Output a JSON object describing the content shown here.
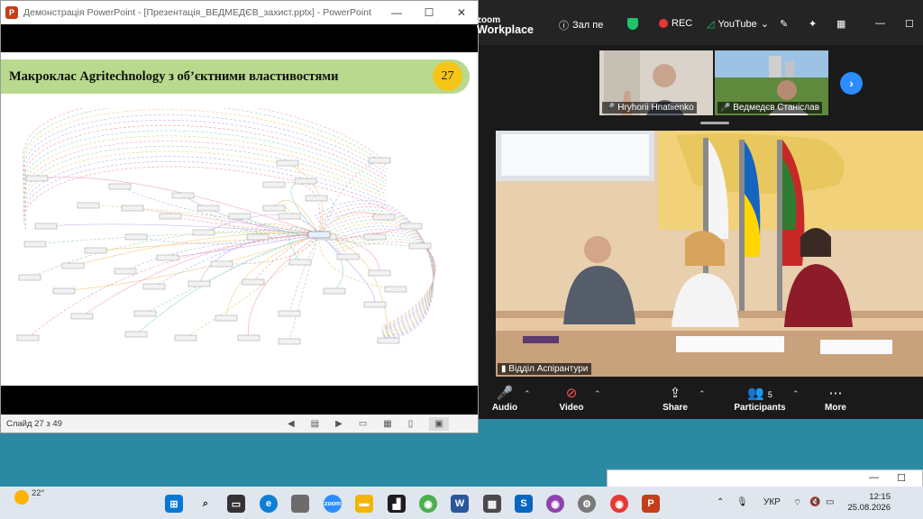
{
  "ppt": {
    "title": "Демонстрація PowerPoint - [Презентація_ВЕДМЕДЄВ_захист.pptx] - PowerPoint",
    "slide_title": "Макроклас  Agritechnology з об’єктними властивостями",
    "slide_number": "27",
    "status": "Слайд 27 з 49"
  },
  "zoom": {
    "brand_top": "zoom",
    "brand_bottom": "Workplace",
    "view_label": "Зал пе",
    "rec_label": "REC",
    "youtube_label": "YouTube",
    "participants": [
      {
        "name": "Hryhorii Hnatiienko"
      },
      {
        "name": "Ведмедєв Станіслав"
      }
    ],
    "main_video_name": "Відділ Аспірантури",
    "toolbar": {
      "audio": "Audio",
      "video": "Video",
      "share": "Share",
      "participants": "Participants",
      "participants_count": "5",
      "more": "More"
    }
  },
  "taskbar": {
    "temperature": "22°",
    "language": "УКР",
    "time": "12:15",
    "date": "25.08.2026"
  }
}
